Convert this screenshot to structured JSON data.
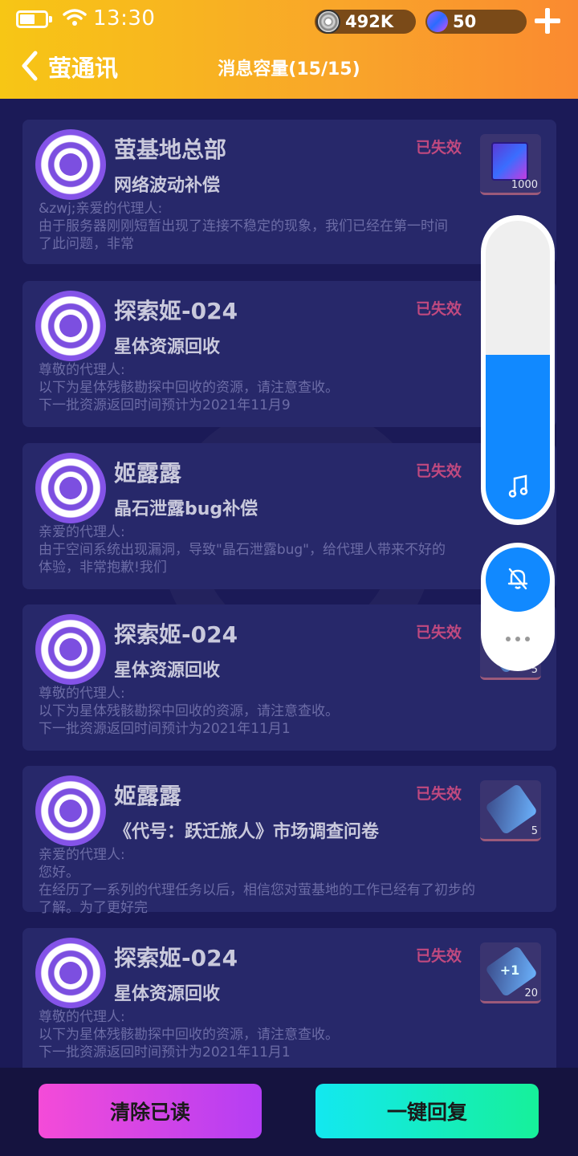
{
  "status_bar": {
    "time": "13:30"
  },
  "currency": {
    "coins": "492K",
    "gems": "50"
  },
  "header": {
    "back_title": "萤通讯",
    "capacity": "消息容量(15/15)"
  },
  "messages": [
    {
      "sender": "萤基地总部",
      "subject": "网络波动补偿",
      "status": "已失效",
      "body": [
        "&zwj;亲爱的代理人:",
        "由于服务器刚刚短暂出现了连接不稳定的现象，我们已经在第一时间",
        "了此问题，非常"
      ],
      "item_qty": "1000",
      "item_icon": "cube-icon"
    },
    {
      "sender": "探索姬-024",
      "subject": "星体资源回收",
      "status": "已失效",
      "body": [
        "尊敬的代理人:",
        "以下为星体残骸勘探中回收的资源，请注意查收。",
        "下一批资源返回时间预计为2021年11月9"
      ],
      "item_qty": "",
      "item_icon": ""
    },
    {
      "sender": "姬露露",
      "subject": "晶石泄露bug补偿",
      "status": "已失效",
      "body": [
        "亲爱的代理人:",
        "由于空间系统出现漏洞，导致\"晶石泄露bug\"，给代理人带来不好的",
        "体验，非常抱歉!我们"
      ],
      "item_qty": "",
      "item_icon": ""
    },
    {
      "sender": "探索姬-024",
      "subject": "星体资源回收",
      "status": "已失效",
      "body": [
        "尊敬的代理人:",
        "以下为星体残骸勘探中回收的资源，请注意查收。",
        "下一批资源返回时间预计为2021年11月1"
      ],
      "item_qty": "5",
      "item_icon": "ticket-icon"
    },
    {
      "sender": "姬露露",
      "subject": "《代号：跃迁旅人》市场调查问卷",
      "status": "已失效",
      "body": [
        "亲爱的代理人:",
        "您好。",
        "在经历了一系列的代理任务以后，相信您对萤基地的工作已经有了初步的",
        "了解。为了更好完"
      ],
      "item_qty": "5",
      "item_icon": "ticket-icon"
    },
    {
      "sender": "探索姬-024",
      "subject": "星体资源回收",
      "status": "已失效",
      "body": [
        "尊敬的代理人:",
        "以下为星体残骸勘探中回收的资源，请注意查收。",
        "下一批资源返回时间预计为2021年11月1"
      ],
      "item_qty": "20",
      "item_icon": "ticket-plus-icon"
    }
  ],
  "volume_overlay": {
    "level": 0.55
  },
  "footer": {
    "clear_read": "清除已读",
    "reply_all": "一键回复"
  }
}
